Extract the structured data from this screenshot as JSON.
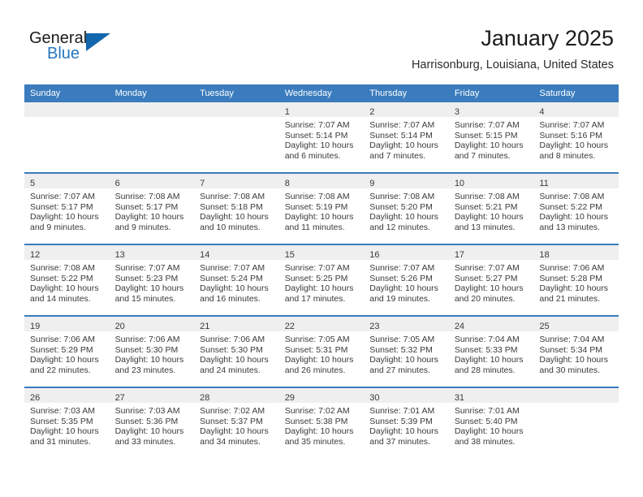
{
  "brand": {
    "name_top": "General",
    "name_bottom": "Blue",
    "accent_color": "#1266ae",
    "text_color": "#1b1b1b"
  },
  "header": {
    "title": "January 2025",
    "subtitle": "Harrisonburg, Louisiana, United States"
  },
  "calendar": {
    "header_bg": "#3a7cbe",
    "daynum_bg": "#efefef",
    "weekday_headers": [
      "Sunday",
      "Monday",
      "Tuesday",
      "Wednesday",
      "Thursday",
      "Friday",
      "Saturday"
    ],
    "labels": {
      "sunrise": "Sunrise:",
      "sunset": "Sunset:",
      "daylight": "Daylight:"
    },
    "weeks": [
      [
        {
          "day": "",
          "empty": true
        },
        {
          "day": "",
          "empty": true
        },
        {
          "day": "",
          "empty": true
        },
        {
          "day": "1",
          "sunrise": "Sunrise: 7:07 AM",
          "sunset": "Sunset: 5:14 PM",
          "daylight_1": "Daylight: 10 hours",
          "daylight_2": "and 6 minutes."
        },
        {
          "day": "2",
          "sunrise": "Sunrise: 7:07 AM",
          "sunset": "Sunset: 5:14 PM",
          "daylight_1": "Daylight: 10 hours",
          "daylight_2": "and 7 minutes."
        },
        {
          "day": "3",
          "sunrise": "Sunrise: 7:07 AM",
          "sunset": "Sunset: 5:15 PM",
          "daylight_1": "Daylight: 10 hours",
          "daylight_2": "and 7 minutes."
        },
        {
          "day": "4",
          "sunrise": "Sunrise: 7:07 AM",
          "sunset": "Sunset: 5:16 PM",
          "daylight_1": "Daylight: 10 hours",
          "daylight_2": "and 8 minutes."
        }
      ],
      [
        {
          "day": "5",
          "sunrise": "Sunrise: 7:07 AM",
          "sunset": "Sunset: 5:17 PM",
          "daylight_1": "Daylight: 10 hours",
          "daylight_2": "and 9 minutes."
        },
        {
          "day": "6",
          "sunrise": "Sunrise: 7:08 AM",
          "sunset": "Sunset: 5:17 PM",
          "daylight_1": "Daylight: 10 hours",
          "daylight_2": "and 9 minutes."
        },
        {
          "day": "7",
          "sunrise": "Sunrise: 7:08 AM",
          "sunset": "Sunset: 5:18 PM",
          "daylight_1": "Daylight: 10 hours",
          "daylight_2": "and 10 minutes."
        },
        {
          "day": "8",
          "sunrise": "Sunrise: 7:08 AM",
          "sunset": "Sunset: 5:19 PM",
          "daylight_1": "Daylight: 10 hours",
          "daylight_2": "and 11 minutes."
        },
        {
          "day": "9",
          "sunrise": "Sunrise: 7:08 AM",
          "sunset": "Sunset: 5:20 PM",
          "daylight_1": "Daylight: 10 hours",
          "daylight_2": "and 12 minutes."
        },
        {
          "day": "10",
          "sunrise": "Sunrise: 7:08 AM",
          "sunset": "Sunset: 5:21 PM",
          "daylight_1": "Daylight: 10 hours",
          "daylight_2": "and 13 minutes."
        },
        {
          "day": "11",
          "sunrise": "Sunrise: 7:08 AM",
          "sunset": "Sunset: 5:22 PM",
          "daylight_1": "Daylight: 10 hours",
          "daylight_2": "and 13 minutes."
        }
      ],
      [
        {
          "day": "12",
          "sunrise": "Sunrise: 7:08 AM",
          "sunset": "Sunset: 5:22 PM",
          "daylight_1": "Daylight: 10 hours",
          "daylight_2": "and 14 minutes."
        },
        {
          "day": "13",
          "sunrise": "Sunrise: 7:07 AM",
          "sunset": "Sunset: 5:23 PM",
          "daylight_1": "Daylight: 10 hours",
          "daylight_2": "and 15 minutes."
        },
        {
          "day": "14",
          "sunrise": "Sunrise: 7:07 AM",
          "sunset": "Sunset: 5:24 PM",
          "daylight_1": "Daylight: 10 hours",
          "daylight_2": "and 16 minutes."
        },
        {
          "day": "15",
          "sunrise": "Sunrise: 7:07 AM",
          "sunset": "Sunset: 5:25 PM",
          "daylight_1": "Daylight: 10 hours",
          "daylight_2": "and 17 minutes."
        },
        {
          "day": "16",
          "sunrise": "Sunrise: 7:07 AM",
          "sunset": "Sunset: 5:26 PM",
          "daylight_1": "Daylight: 10 hours",
          "daylight_2": "and 19 minutes."
        },
        {
          "day": "17",
          "sunrise": "Sunrise: 7:07 AM",
          "sunset": "Sunset: 5:27 PM",
          "daylight_1": "Daylight: 10 hours",
          "daylight_2": "and 20 minutes."
        },
        {
          "day": "18",
          "sunrise": "Sunrise: 7:06 AM",
          "sunset": "Sunset: 5:28 PM",
          "daylight_1": "Daylight: 10 hours",
          "daylight_2": "and 21 minutes."
        }
      ],
      [
        {
          "day": "19",
          "sunrise": "Sunrise: 7:06 AM",
          "sunset": "Sunset: 5:29 PM",
          "daylight_1": "Daylight: 10 hours",
          "daylight_2": "and 22 minutes."
        },
        {
          "day": "20",
          "sunrise": "Sunrise: 7:06 AM",
          "sunset": "Sunset: 5:30 PM",
          "daylight_1": "Daylight: 10 hours",
          "daylight_2": "and 23 minutes."
        },
        {
          "day": "21",
          "sunrise": "Sunrise: 7:06 AM",
          "sunset": "Sunset: 5:30 PM",
          "daylight_1": "Daylight: 10 hours",
          "daylight_2": "and 24 minutes."
        },
        {
          "day": "22",
          "sunrise": "Sunrise: 7:05 AM",
          "sunset": "Sunset: 5:31 PM",
          "daylight_1": "Daylight: 10 hours",
          "daylight_2": "and 26 minutes."
        },
        {
          "day": "23",
          "sunrise": "Sunrise: 7:05 AM",
          "sunset": "Sunset: 5:32 PM",
          "daylight_1": "Daylight: 10 hours",
          "daylight_2": "and 27 minutes."
        },
        {
          "day": "24",
          "sunrise": "Sunrise: 7:04 AM",
          "sunset": "Sunset: 5:33 PM",
          "daylight_1": "Daylight: 10 hours",
          "daylight_2": "and 28 minutes."
        },
        {
          "day": "25",
          "sunrise": "Sunrise: 7:04 AM",
          "sunset": "Sunset: 5:34 PM",
          "daylight_1": "Daylight: 10 hours",
          "daylight_2": "and 30 minutes."
        }
      ],
      [
        {
          "day": "26",
          "sunrise": "Sunrise: 7:03 AM",
          "sunset": "Sunset: 5:35 PM",
          "daylight_1": "Daylight: 10 hours",
          "daylight_2": "and 31 minutes."
        },
        {
          "day": "27",
          "sunrise": "Sunrise: 7:03 AM",
          "sunset": "Sunset: 5:36 PM",
          "daylight_1": "Daylight: 10 hours",
          "daylight_2": "and 33 minutes."
        },
        {
          "day": "28",
          "sunrise": "Sunrise: 7:02 AM",
          "sunset": "Sunset: 5:37 PM",
          "daylight_1": "Daylight: 10 hours",
          "daylight_2": "and 34 minutes."
        },
        {
          "day": "29",
          "sunrise": "Sunrise: 7:02 AM",
          "sunset": "Sunset: 5:38 PM",
          "daylight_1": "Daylight: 10 hours",
          "daylight_2": "and 35 minutes."
        },
        {
          "day": "30",
          "sunrise": "Sunrise: 7:01 AM",
          "sunset": "Sunset: 5:39 PM",
          "daylight_1": "Daylight: 10 hours",
          "daylight_2": "and 37 minutes."
        },
        {
          "day": "31",
          "sunrise": "Sunrise: 7:01 AM",
          "sunset": "Sunset: 5:40 PM",
          "daylight_1": "Daylight: 10 hours",
          "daylight_2": "and 38 minutes."
        },
        {
          "day": "",
          "empty": true
        }
      ]
    ]
  }
}
